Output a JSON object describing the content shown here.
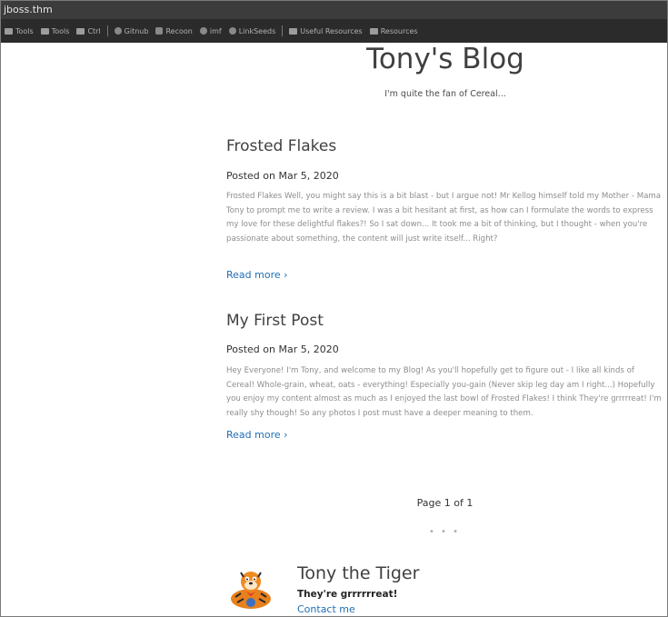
{
  "window": {
    "title": "jboss.thm"
  },
  "bookmarks": [
    {
      "icon": "folder-icon",
      "label": "Tools"
    },
    {
      "icon": "folder-icon",
      "label": "Tools"
    },
    {
      "icon": "folder-icon",
      "label": "Ctrl"
    },
    {
      "icon": "globe-icon",
      "label": "Gitnub"
    },
    {
      "icon": "globe-icon",
      "label": "Recoon"
    },
    {
      "icon": "globe-icon",
      "label": "imf"
    },
    {
      "icon": "globe-icon",
      "label": "LinkSeeds"
    },
    {
      "icon": "folder-icon",
      "label": "Useful Resources"
    },
    {
      "icon": "folder-icon",
      "label": "Resources"
    }
  ],
  "blog": {
    "title": "Tony's Blog",
    "subtitle": "I'm quite the fan of Cereal..."
  },
  "posts": [
    {
      "title": "Frosted Flakes",
      "date": "Posted on Mar 5, 2020",
      "excerpt": "Frosted Flakes Well, you might say this is a bit blast - but I argue not! Mr Kellog himself told my Mother - Mama Tony to prompt me to write a review. I was a bit hesitant at first, as how can I formulate the words to express my love for these delightful flakes?! So I sat down... It took me a bit of thinking, but I thought - when you're passionate about something, the content will just write itself... Right?",
      "read_more": "Read more ›"
    },
    {
      "title": "My First Post",
      "date": "Posted on Mar 5, 2020",
      "excerpt": "Hey Everyone! I'm Tony, and welcome to my Blog! As you'll hopefully get to figure out - I like all kinds of Cereal! Whole-grain, wheat, oats - everything! Especially you-gain (Never skip leg day am I right...) Hopefully you enjoy my content almost as much as I enjoyed the last bowl of Frosted Flakes! I think They're grrrrreat! I'm really shy though! So any photos I post must have a deeper meaning to them.",
      "read_more": "Read more ›"
    }
  ],
  "pagination": {
    "text": "Page 1 of 1"
  },
  "separator": "• • •",
  "author": {
    "name": "Tony the Tiger",
    "tagline": "They're grrrrrreat!",
    "contact": "Contact me"
  },
  "colors": {
    "link": "#1f6fb5",
    "text": "#404040",
    "excerpt": "#8d8d8d",
    "chrome": "#2b2b2b"
  }
}
